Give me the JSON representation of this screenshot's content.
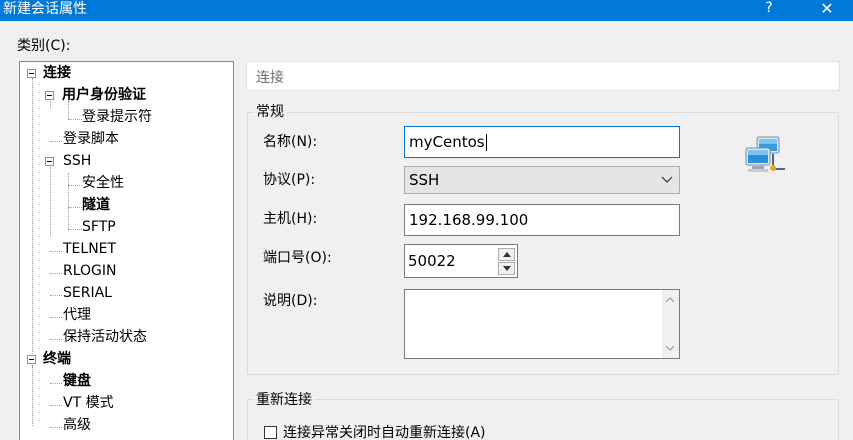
{
  "window": {
    "title": "新建会话属性",
    "help_glyph": "?",
    "close_glyph": "✕"
  },
  "category_label": "类别(C):",
  "tree": {
    "connection": "连接",
    "auth": "用户身份验证",
    "login_prompts": "登录提示符",
    "login_script": "登录脚本",
    "ssh": "SSH",
    "security": "安全性",
    "tunnel": "隧道",
    "sftp": "SFTP",
    "telnet": "TELNET",
    "rlogin": "RLOGIN",
    "serial": "SERIAL",
    "proxy": "代理",
    "keepalive": "保持活动状态",
    "terminal": "终端",
    "keyboard": "键盘",
    "vt_mode": "VT 模式",
    "advanced": "高级"
  },
  "section_header": "连接",
  "general": {
    "title": "常规",
    "name_label": "名称(N):",
    "name_value": "myCentos",
    "protocol_label": "协议(P):",
    "protocol_value": "SSH",
    "host_label": "主机(H):",
    "host_value": "192.168.99.100",
    "port_label": "端口号(O):",
    "port_value": "50022",
    "desc_label": "说明(D):",
    "desc_value": ""
  },
  "reconnect": {
    "title": "重新连接",
    "checkbox_label": "连接异常关闭时自动重新连接(A)",
    "checked": false
  },
  "colors": {
    "title_bar": "#0078d7",
    "focus_border": "#0078d7"
  },
  "icons": {
    "network": "network-computers-icon"
  }
}
